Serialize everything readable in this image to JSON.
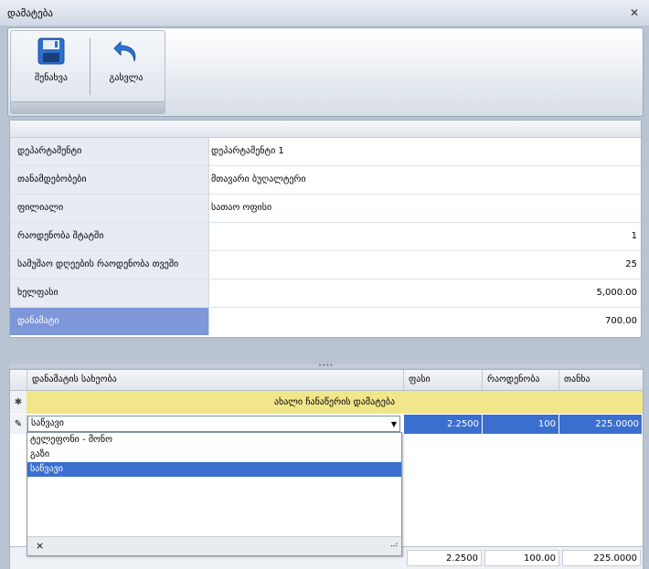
{
  "window": {
    "title": "დამატება",
    "close_glyph": "✕"
  },
  "ribbon": {
    "save_label": "შენახვა",
    "exit_label": "გასვლა"
  },
  "details": {
    "rows": [
      {
        "label": "დეპარტამენტი",
        "value": "დეპარტამენტი 1"
      },
      {
        "label": "თანამდებობები",
        "value": "მთავარი ბუღალტერი"
      },
      {
        "label": "ფილიალი",
        "value": "სათაო ოფისი"
      },
      {
        "label": "რაოდენობა შტატში",
        "value": "1"
      },
      {
        "label": "სამუშაო დღეების რაოდენობა თვეში",
        "value": "25"
      },
      {
        "label": "ხელფასი",
        "value": "5,000.00"
      },
      {
        "label": "დანამატი",
        "value": "700.00"
      }
    ]
  },
  "bonus_grid": {
    "columns": [
      "დანამატის სახეობა",
      "ფასი",
      "რაოდენობა",
      "თანხა"
    ],
    "new_row_indicator": "✱",
    "new_row_text": "ახალი ჩანაწერის დამატება",
    "edit_row_indicator": "✎",
    "edit_row": {
      "type_value": "საწვავი",
      "price": "2.2500",
      "quantity": "100",
      "amount": "225.0000"
    },
    "dropdown": {
      "options": [
        "ტელეფონი - მონო",
        "გაზი",
        "საწვავი"
      ],
      "selected_index": 2,
      "clear_glyph": "×",
      "grip_glyph": "⠠⠴"
    },
    "footer": {
      "price": "2.2500",
      "quantity": "100.00",
      "amount": "225.0000"
    }
  },
  "colors": {
    "selection": "#3a6fd0",
    "new_row_bg": "#f2e68a",
    "selected_label_bg": "#7d97d8"
  }
}
